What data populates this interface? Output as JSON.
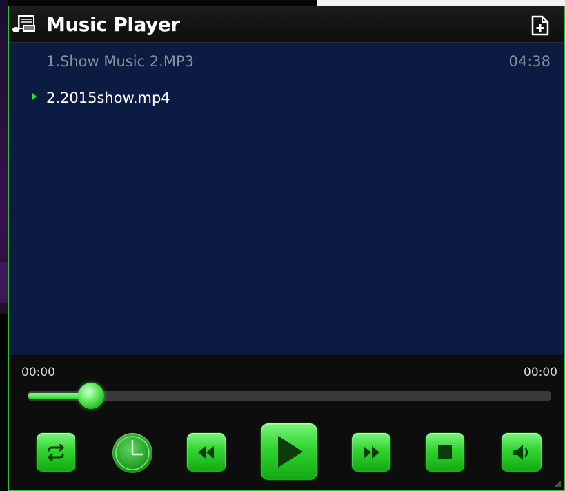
{
  "window": {
    "title": "Music Player",
    "icons": {
      "app": "music-notes-icon",
      "add": "add-file-icon"
    },
    "accent_color": "#2ed42e",
    "playlist_bg": "#0c1b42"
  },
  "playlist": {
    "tracks": [
      {
        "label": "1.Show Music 2.MP3",
        "duration": "04:38",
        "current": false
      },
      {
        "label": "2.2015show.mp4",
        "duration": "",
        "current": true
      }
    ]
  },
  "player": {
    "current_time": "00:00",
    "total_time": "00:00",
    "progress_fraction": 0.12
  },
  "controls": [
    {
      "name": "repeat",
      "icon": "repeat-icon"
    },
    {
      "name": "timer",
      "icon": "clock-icon"
    },
    {
      "name": "previous",
      "icon": "rewind-icon"
    },
    {
      "name": "play",
      "icon": "play-icon"
    },
    {
      "name": "next",
      "icon": "fast-forward-icon"
    },
    {
      "name": "stop",
      "icon": "stop-icon"
    },
    {
      "name": "volume",
      "icon": "speaker-icon"
    }
  ]
}
